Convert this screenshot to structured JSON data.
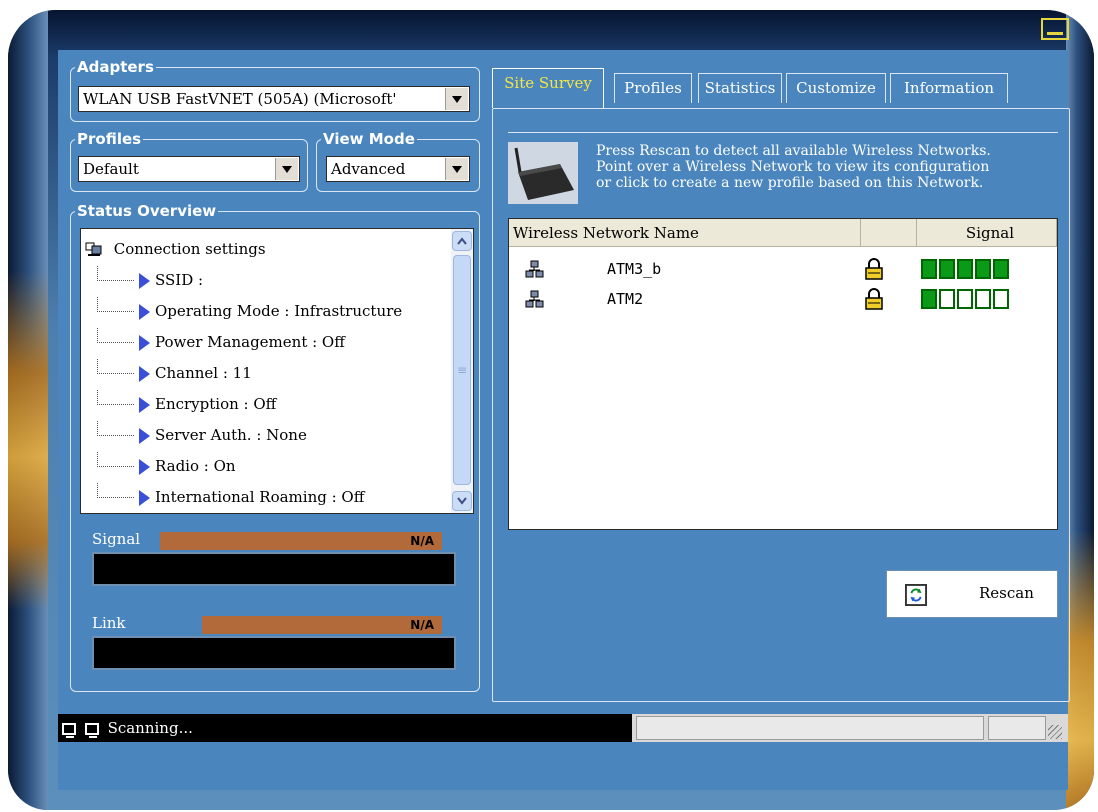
{
  "adapters": {
    "legend": "Adapters",
    "value": "WLAN USB FastVNET (505A) (Microsoft'"
  },
  "profiles": {
    "legend": "Profiles",
    "value": "Default"
  },
  "view_mode": {
    "legend": "View Mode",
    "value": "Advanced"
  },
  "status_overview": {
    "legend": "Status Overview",
    "root": "Connection settings",
    "items": [
      "SSID :",
      "Operating Mode : Infrastructure",
      "Power Management : Off",
      "Channel : 11",
      "Encryption : Off",
      "Server Auth. : None",
      "Radio : On",
      "International Roaming : Off"
    ]
  },
  "meters": {
    "signal_label": "Signal",
    "signal_value": "N/A",
    "link_label": "Link",
    "link_value": "N/A"
  },
  "tabs": [
    "Site Survey",
    "Profiles",
    "Statistics",
    "Customize",
    "Information"
  ],
  "site_survey": {
    "instructions": [
      "Press Rescan to detect all available Wireless Networks.",
      "Point over a Wireless Network to view its configuration",
      "or click to create a new profile based on this Network."
    ],
    "columns": {
      "name": "Wireless Network Name",
      "signal": "Signal"
    },
    "networks": [
      {
        "name": "ATM3_b",
        "locked": true,
        "signal_bars": 5
      },
      {
        "name": "ATM2",
        "locked": true,
        "signal_bars": 1
      }
    ],
    "rescan_label": "Rescan"
  },
  "statusbar": {
    "text": "Scanning..."
  },
  "colors": {
    "panel_bg": "#4a86bd",
    "active_tab": "#f2e54a",
    "signal_green": "#0a9a17",
    "meter_strip": "#b36a3a"
  },
  "icons": [
    "minimize-icon",
    "network-computer-icon",
    "wireless-router-icon",
    "lock-icon",
    "refresh-icon",
    "monitor-icon",
    "size-grip-icon"
  ]
}
